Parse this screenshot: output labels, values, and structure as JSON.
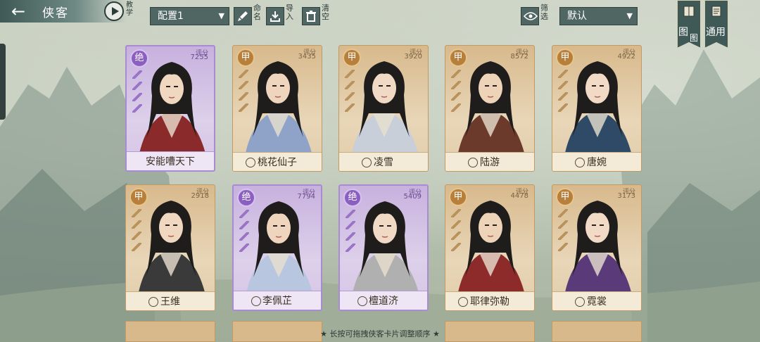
{
  "header": {
    "title": "侠客",
    "tutorial_label": "教学",
    "config_value": "配置1",
    "rename_label": "命名",
    "import_label": "导入",
    "clear_label": "清空",
    "filter_label": "筛选",
    "sort_value": "默认",
    "codex_label": "图鉴",
    "general_label": "通用"
  },
  "score_label": "评分",
  "cards": [
    {
      "name": "安能嘈天下",
      "rank": "绝",
      "score": "7255",
      "tier": "purple"
    },
    {
      "name": "桃花仙子",
      "rank": "甲",
      "score": "3435",
      "tier": "gold"
    },
    {
      "name": "凌雪",
      "rank": "甲",
      "score": "3920",
      "tier": "gold"
    },
    {
      "name": "陆游",
      "rank": "甲",
      "score": "8572",
      "tier": "gold"
    },
    {
      "name": "唐婉",
      "rank": "甲",
      "score": "4922",
      "tier": "gold"
    },
    {
      "name": "王维",
      "rank": "甲",
      "score": "2918",
      "tier": "gold"
    },
    {
      "name": "李佩芷",
      "rank": "绝",
      "score": "7794",
      "tier": "purple"
    },
    {
      "name": "檀道济",
      "rank": "绝",
      "score": "5409",
      "tier": "purple"
    },
    {
      "name": "耶律弥勒",
      "rank": "甲",
      "score": "4478",
      "tier": "gold"
    },
    {
      "name": "霓裳",
      "rank": "甲",
      "score": "3173",
      "tier": "gold"
    }
  ],
  "footer": {
    "hint": "★ 长按可拖拽侠客卡片调整顺序 ★"
  },
  "colors": {
    "gold_card": "#d8b98c",
    "purple_card": "#c7b1de",
    "toolbar": "#4f6662"
  }
}
